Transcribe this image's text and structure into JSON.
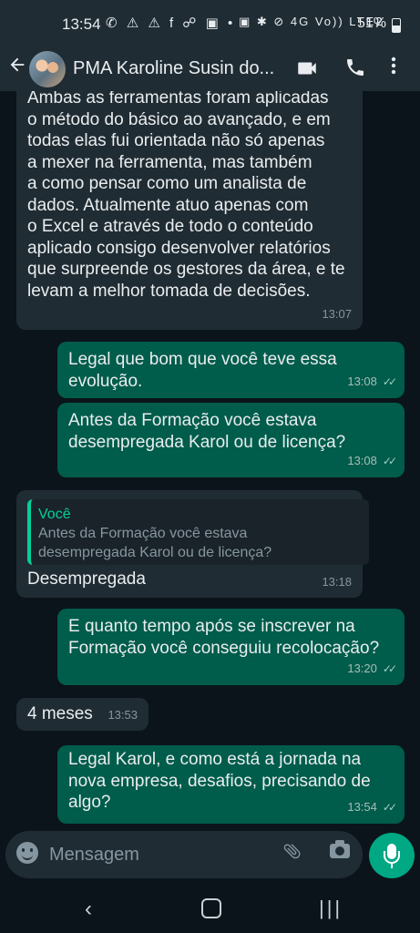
{
  "status_bar": {
    "time": "13:54",
    "left_icons": "✆ ⚠ ⚠ f ☍ ▣ •",
    "right_icons": "▣ ✱ ⊘ 4G Vo)) LTE2",
    "battery": "51%"
  },
  "header": {
    "back_icon": "arrow-left",
    "contact_name": "PMA Karoline Susin do...",
    "video_icon": "videocam",
    "call_icon": "phone",
    "menu_icon": "more-vertical"
  },
  "messages": [
    {
      "direction": "in",
      "text": "Ambas as ferramentas foram aplicadas o método do básico ao avançado, e em todas elas fui orientada não só apenas a mexer na ferramenta, mas também a como pensar como um analista de dados. Atualmente atuo apenas com o Excel e através de todo o conteúdo aplicado consigo desenvolver relatórios que surpreende os gestores da área, e te levam a melhor tomada de decisões.",
      "lines": [
        "Ambas as ferramentas foram aplicadas",
        "o método do básico ao avançado, e em",
        "todas elas fui orientada não só apenas",
        "a mexer na ferramenta, mas também",
        "a como pensar como um analista de",
        "dados. Atualmente atuo apenas com",
        "o Excel e através de todo o conteúdo",
        "aplicado consigo desenvolver relatórios",
        "que surpreende os gestores da área, e te",
        "levam a melhor tomada de decisões."
      ],
      "time": "13:07"
    },
    {
      "direction": "out",
      "lines": [
        "Legal que bom que você teve essa",
        "evolução."
      ],
      "time": "13:08",
      "ticks": "✓✓"
    },
    {
      "direction": "out",
      "lines": [
        "Antes da Formação você estava",
        "desempregada Karol ou de licença?"
      ],
      "time": "13:08",
      "ticks": "✓✓"
    },
    {
      "direction": "in",
      "quote_author": "Você",
      "quote_lines": [
        "Antes da Formação você estava",
        "desempregada Karol ou de licença?"
      ],
      "text": "Desempregada",
      "time": "13:18"
    },
    {
      "direction": "out",
      "lines": [
        "E quanto tempo após se inscrever na",
        "Formação você conseguiu recolocação?"
      ],
      "time": "13:20",
      "ticks": "✓✓"
    },
    {
      "direction": "in",
      "text": "4 meses",
      "time": "13:53"
    },
    {
      "direction": "out",
      "lines": [
        "Legal Karol, e como está a jornada na",
        "nova empresa, desafios, precisando de",
        "algo?"
      ],
      "time": "13:54",
      "ticks": "✓✓"
    }
  ],
  "composer": {
    "placeholder": "Mensagem",
    "emoji_icon": "emoji",
    "attach_icon": "paperclip",
    "camera_icon": "camera",
    "mic_icon": "microphone"
  },
  "navbar": {
    "back": "‹",
    "home": "",
    "recents": "|||"
  }
}
